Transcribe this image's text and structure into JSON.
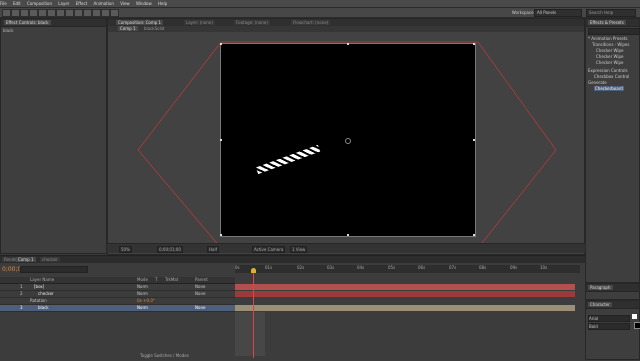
{
  "menu": [
    "File",
    "Edit",
    "Composition",
    "Layer",
    "Effect",
    "Animation",
    "View",
    "Window",
    "Help"
  ],
  "toolbar": {
    "workspace_label": "Workspace:",
    "workspace_value": "All Panels",
    "search_placeholder": "Search Help"
  },
  "left_panel": {
    "tab": "Effect Controls: black",
    "item": "black"
  },
  "comp_tabs": {
    "viewer_tabs": [
      "Composition: Comp 1",
      "Layer: (none)",
      "Footage: (none)",
      "Flowchart: (none)"
    ],
    "comp_breadcrumb": [
      "Comp 1",
      "blackSolid"
    ]
  },
  "viewer_bar": {
    "zoom": "50%",
    "timecode": "0;00;01;00",
    "resolution": "Half",
    "camera": "Active Camera",
    "views": "1 View"
  },
  "timeline": {
    "tabs": [
      "Render Queue",
      "Comp 1",
      "checker"
    ],
    "current_time": "0;00;01;00",
    "columns": [
      "Layer Name",
      "Mode",
      "T",
      "TrkMat",
      "Parent"
    ],
    "layers": [
      {
        "num": "1",
        "name": "[box]",
        "mode": "Norm",
        "parent": "None"
      },
      {
        "num": "2",
        "name": "checker",
        "mode": "Norm",
        "parent": "None"
      },
      {
        "num": "",
        "name": "Rotation",
        "value": "0x +0.0°"
      },
      {
        "num": "3",
        "name": "black",
        "mode": "Norm",
        "parent": "None"
      }
    ],
    "ruler_ticks": [
      "0s",
      "01s",
      "02s",
      "03s",
      "04s",
      "05s",
      "06s",
      "07s",
      "08s",
      "09s",
      "10s"
    ],
    "footer": "Toggle Switches / Modes"
  },
  "right_panel": {
    "tab": "Effects & Presets",
    "items": [
      "* Animation Presets",
      "Transitions - Wipes",
      "Checker Wipe",
      "Checker Wipe",
      "Checker Wipe",
      "Expression Controls",
      "Checkbox Control",
      "Generate",
      "Checkerboard"
    ],
    "paragraph_tab": "Paragraph",
    "character_tab": "Character",
    "font_value": "Arial",
    "style_value": "Bold"
  },
  "colors": {
    "accent_red": "#b83b3b",
    "layer_red": "#9a3a3a",
    "layer_tan": "#9b8f76",
    "selection_blue": "#4d5f7a"
  }
}
